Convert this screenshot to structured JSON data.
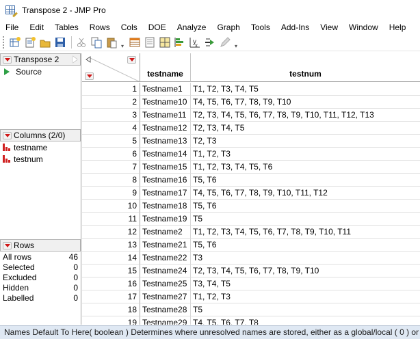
{
  "window": {
    "title": "Transpose 2 - JMP Pro"
  },
  "menu": [
    "File",
    "Edit",
    "Tables",
    "Rows",
    "Cols",
    "DOE",
    "Analyze",
    "Graph",
    "Tools",
    "Add-Ins",
    "View",
    "Window",
    "Help"
  ],
  "toolbar": {
    "buttons": [
      "new-data-table-icon",
      "new-script-icon",
      "open-file-icon",
      "save-icon",
      "cut-icon",
      "copy-icon",
      "paste-icon",
      "data-table-icon",
      "journal-icon",
      "graph-builder-icon",
      "distribution-icon",
      "fit-y-by-x-icon",
      "fit-model-icon",
      "annotate-icon"
    ]
  },
  "left_panel": {
    "table_panel": {
      "title": "Transpose 2",
      "items": [
        "Source"
      ]
    },
    "columns_panel": {
      "title": "Columns (2/0)",
      "columns": [
        "testname",
        "testnum"
      ]
    },
    "rows_panel": {
      "title": "Rows",
      "stats": [
        {
          "label": "All rows",
          "value": "46"
        },
        {
          "label": "Selected",
          "value": "0"
        },
        {
          "label": "Excluded",
          "value": "0"
        },
        {
          "label": "Hidden",
          "value": "0"
        },
        {
          "label": "Labelled",
          "value": "0"
        }
      ]
    }
  },
  "table": {
    "headers": [
      "testname",
      "testnum"
    ],
    "rows": [
      {
        "n": "1",
        "testname": "Testname1",
        "testnum": "T1, T2, T3, T4, T5"
      },
      {
        "n": "2",
        "testname": "Testname10",
        "testnum": "T4, T5, T6, T7, T8, T9, T10"
      },
      {
        "n": "3",
        "testname": "Testname11",
        "testnum": "T2, T3, T4, T5, T6, T7, T8, T9, T10, T11, T12, T13"
      },
      {
        "n": "4",
        "testname": "Testname12",
        "testnum": "T2, T3, T4, T5"
      },
      {
        "n": "5",
        "testname": "Testname13",
        "testnum": "T2, T3"
      },
      {
        "n": "6",
        "testname": "Testname14",
        "testnum": "T1, T2, T3"
      },
      {
        "n": "7",
        "testname": "Testname15",
        "testnum": "T1, T2, T3, T4, T5, T6"
      },
      {
        "n": "8",
        "testname": "Testname16",
        "testnum": "T5, T6"
      },
      {
        "n": "9",
        "testname": "Testname17",
        "testnum": "T4, T5, T6, T7, T8, T9, T10, T11, T12"
      },
      {
        "n": "10",
        "testname": "Testname18",
        "testnum": "T5, T6"
      },
      {
        "n": "11",
        "testname": "Testname19",
        "testnum": "T5"
      },
      {
        "n": "12",
        "testname": "Testname2",
        "testnum": "T1, T2, T3, T4, T5, T6, T7, T8, T9, T10, T11"
      },
      {
        "n": "13",
        "testname": "Testname21",
        "testnum": "T5, T6"
      },
      {
        "n": "14",
        "testname": "Testname22",
        "testnum": "T3"
      },
      {
        "n": "15",
        "testname": "Testname24",
        "testnum": "T2, T3, T4, T5, T6, T7, T8, T9, T10"
      },
      {
        "n": "16",
        "testname": "Testname25",
        "testnum": "T3, T4, T5"
      },
      {
        "n": "17",
        "testname": "Testname27",
        "testnum": "T1, T2, T3"
      },
      {
        "n": "18",
        "testname": "Testname28",
        "testnum": "T5"
      },
      {
        "n": "19",
        "testname": "Testname29",
        "testnum": "T4, T5, T6, T7, T8"
      }
    ]
  },
  "status_bar": {
    "text": "Names Default To Here( boolean )  Determines where unresolved names are stored, either as a global/local ( 0 ) or in"
  },
  "colors": {
    "accent_red": "#d01818",
    "play_green": "#2fa046",
    "status_bg": "#dfe8f3"
  }
}
